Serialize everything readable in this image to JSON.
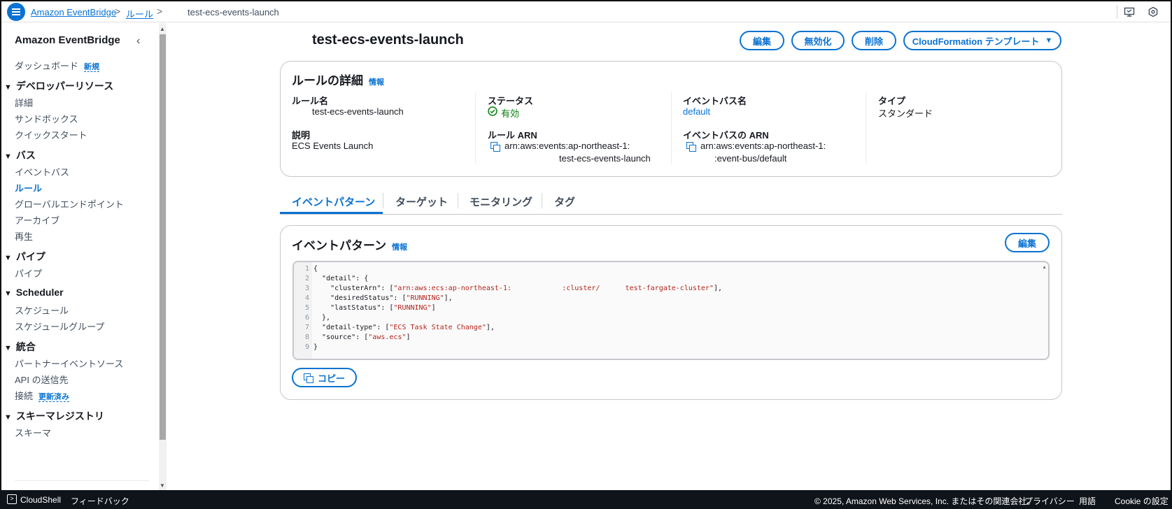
{
  "breadcrumb": {
    "items": [
      "Amazon EventBridge",
      "ルール"
    ],
    "current": "test-ecs-events-launch"
  },
  "sidebar": {
    "title": "Amazon EventBridge",
    "dashboard": "ダッシュボード",
    "dashboard_badge": "新規",
    "groups": [
      {
        "label": "デベロッパーリソース",
        "items": [
          "詳細",
          "サンドボックス",
          "クイックスタート"
        ]
      },
      {
        "label": "バス",
        "items": [
          "イベントバス",
          "ルール",
          "グローバルエンドポイント",
          "アーカイブ",
          "再生"
        ]
      },
      {
        "label": "パイプ",
        "items": [
          "パイプ"
        ]
      },
      {
        "label": "Scheduler",
        "items": [
          "スケジュール",
          "スケジュールグループ"
        ]
      },
      {
        "label": "統合",
        "items": [
          "パートナーイベントソース",
          "API の送信先",
          "接続"
        ]
      },
      {
        "label": "スキーマレジストリ",
        "items": [
          "スキーマ"
        ]
      }
    ],
    "connection_badge": "更新済み",
    "active_item": "ルール"
  },
  "header": {
    "title": "test-ecs-events-launch",
    "buttons": {
      "edit": "編集",
      "disable": "無効化",
      "delete": "削除",
      "cloudformation": "CloudFormation テンプレート"
    }
  },
  "details": {
    "title": "ルールの詳細",
    "info": "情報",
    "rule_name_label": "ルール名",
    "rule_name": "test-ecs-events-launch",
    "description_label": "説明",
    "description": "ECS Events Launch",
    "status_label": "ステータス",
    "status": "有効",
    "rule_arn_label": "ルール ARN",
    "rule_arn_line1": "arn:aws:events:ap-northeast-1:",
    "rule_arn_line2": "test-ecs-events-launch",
    "event_bus_name_label": "イベントバス名",
    "event_bus_name": "default",
    "event_bus_arn_label": "イベントバスの ARN",
    "event_bus_arn_line1": "arn:aws:events:ap-northeast-1:",
    "event_bus_arn_line2": ":event-bus/default",
    "type_label": "タイプ",
    "type": "スタンダード"
  },
  "tabs": [
    "イベントパターン",
    "ターゲット",
    "モニタリング",
    "タグ"
  ],
  "pattern": {
    "title": "イベントパターン",
    "info": "情報",
    "edit": "編集",
    "copy": "コピー",
    "lines": [
      {
        "n": "1",
        "text": "{"
      },
      {
        "n": "2",
        "text": "  \"detail\": {"
      },
      {
        "n": "3",
        "text": "    \"clusterArn\": [\"arn:aws:ecs:ap-northeast-1:            :cluster/      test-fargate-cluster\"],"
      },
      {
        "n": "4",
        "text": "    \"desiredStatus\": [\"RUNNING\"],"
      },
      {
        "n": "5",
        "text": "    \"lastStatus\": [\"RUNNING\"]"
      },
      {
        "n": "6",
        "text": "  },"
      },
      {
        "n": "7",
        "text": "  \"detail-type\": [\"ECS Task State Change\"],"
      },
      {
        "n": "8",
        "text": "  \"source\": [\"aws.ecs\"]"
      },
      {
        "n": "9",
        "text": "}"
      }
    ]
  },
  "footer": {
    "cloudshell": "CloudShell",
    "feedback": "フィードバック",
    "copyright": "© 2025, Amazon Web Services, Inc. またはその関連会社。",
    "privacy": "プライバシー",
    "terms": "用語",
    "cookie": "Cookie の設定"
  },
  "colors": {
    "accent": "#0972d3",
    "success": "#037f0c",
    "footer": "#0f141a"
  }
}
